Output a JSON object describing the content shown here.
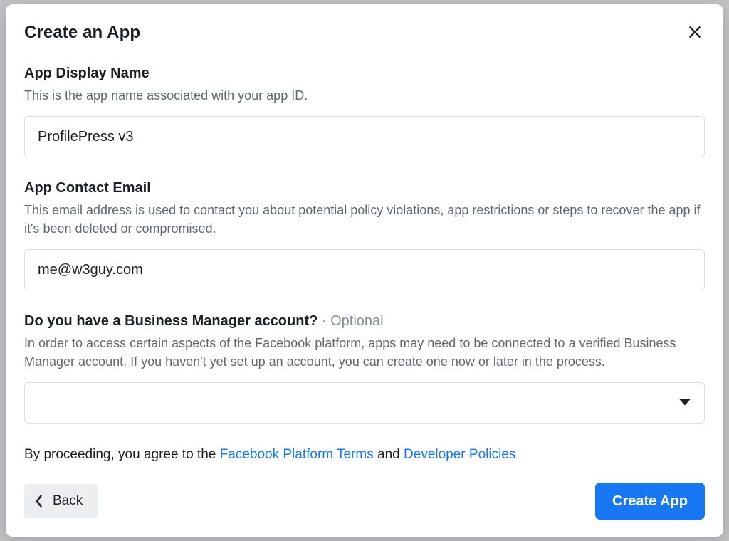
{
  "modal": {
    "title": "Create an App",
    "fields": {
      "display_name": {
        "label": "App Display Name",
        "hint": "This is the app name associated with your app ID.",
        "value": "ProfilePress v3"
      },
      "contact_email": {
        "label": "App Contact Email",
        "hint": "This email address is used to contact you about potential policy violations, app restrictions or steps to recover the app if it's been deleted or compromised.",
        "value": "me@w3guy.com"
      },
      "business_manager": {
        "label": "Do you have a Business Manager account?",
        "meta_sep": " · ",
        "meta": "Optional",
        "hint": "In order to access certain aspects of the Facebook platform, apps may need to be connected to a verified Business Manager account. If you haven't yet set up an account, you can create one now or later in the process.",
        "value": ""
      }
    },
    "footer": {
      "agree_prefix": "By proceeding, you agree to the ",
      "terms_link": "Facebook Platform Terms",
      "agree_mid": " and ",
      "policies_link": "Developer Policies",
      "back_label": "Back",
      "primary_label": "Create App"
    }
  }
}
